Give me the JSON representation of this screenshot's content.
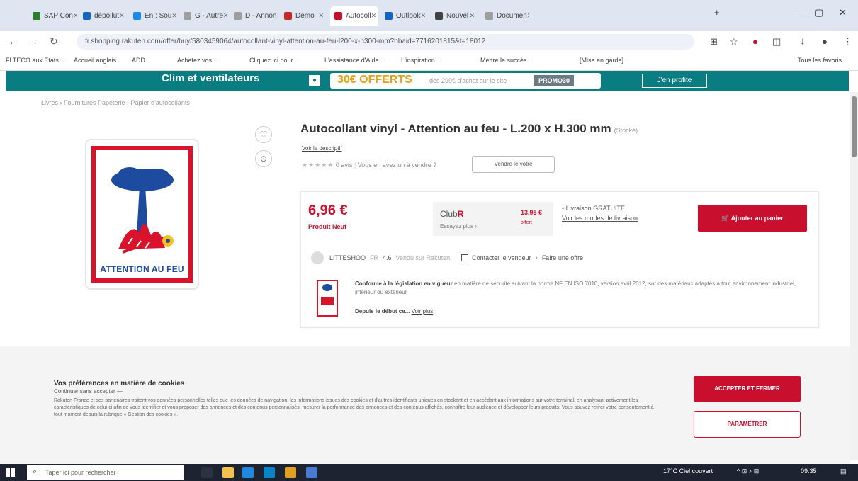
{
  "browser": {
    "tabs": [
      {
        "title": "SAP Con",
        "fav": "#2e7d32",
        "active": false
      },
      {
        "title": "dépollut",
        "fav": "#1565c0",
        "active": false
      },
      {
        "title": "En : Sou",
        "fav": "#1e88e5",
        "active": false
      },
      {
        "title": "G - Autre",
        "fav": "#9e9e9e",
        "active": false
      },
      {
        "title": "D - Annon",
        "fav": "#9e9e9e",
        "active": false
      },
      {
        "title": "Demo",
        "fav": "#c62828",
        "active": false
      },
      {
        "title": "Autocoll",
        "fav": "#c8102e",
        "active": true
      },
      {
        "title": "Outlook",
        "fav": "#1565c0",
        "active": false
      },
      {
        "title": "Nouvel",
        "fav": "#424242",
        "active": false
      },
      {
        "title": "Documen",
        "fav": "#9e9e9e",
        "active": false
      }
    ],
    "new_tab": "+",
    "url": "fr.shopping.rakuten.com/offer/buy/5803459064/autocollant-vinyl-attention-au-feu-l200-x-h300-mm?bbaid=7716201815&t=18012",
    "bookmarks": [
      "FLTECO aux Etats...",
      "Accueil anglais",
      "ADD",
      "Achetez vos...",
      "Cliquez ici pour...",
      "L'assistance d'Aide...",
      "L'inspiration...",
      "Mettre le succès...",
      "[Mise en garde]..."
    ],
    "all_bookmarks": "Tous les favoris"
  },
  "promo": {
    "title": "Clim et ventilateurs",
    "offer": "30€ OFFERTS",
    "offer_small": "dès 299€ d'achat sur le site",
    "code": "PROMO30",
    "cta": "J'en profite"
  },
  "breadcrumb": "Livres › Fournitures Papeterie › Papier d'autocollants",
  "product": {
    "image_text": "ATTENTION AU FEU",
    "title": "Autocollant vinyl - Attention au feu - L.200 x H.300 mm",
    "title_meta": "(Stocké)",
    "desc_link": "Voir le descriptif",
    "stars": "★★★★★",
    "reviews": "0 avis",
    "sell_prompt": "Vous en avez un à vendre ?",
    "sell_button": "Vendre le vôtre"
  },
  "buybox": {
    "price": "6,96 €",
    "condition": "Produit Neuf",
    "club_label": "Club",
    "club_r": "R",
    "club_sub": "Essayez plus ›",
    "club_price": "13,95 €",
    "club_save": "offert",
    "delivery_1": "• Livraison GRATUITE",
    "delivery_2": "Voir les modes de livraison",
    "add_to_cart": "Ajouter au panier",
    "seller_name": "LITTESHOO",
    "seller_country": "FR",
    "seller_rating": "4.6",
    "seller_sales": "Vendu sur Rakuten",
    "contact": "Contacter le vendeur",
    "offer": "Faire une offre",
    "conform_bold": "Conforme à la législation en vigueur",
    "conform_text": "en matière de sécurité suivant la norme NF EN ISO 7010, version avril 2012, sur des matériaux adaptés à tout environnement industriel, intérieur ou extérieur",
    "depuis": "Depuis le début ce...",
    "voir_plus": "Voir plus"
  },
  "cookie": {
    "title": "Vos préférences en matière de cookies",
    "continue": "Continuer sans accepter —",
    "body": "Rakuten France et ses partenaires traitent vos données personnelles telles que les données de navigation, les informations issues des cookies et d'autres identifiants uniques en stockant et en accédant aux informations sur votre terminal, en analysant activement les caractéristiques de celui-ci afin de vous identifier et vous proposer des annonces et des contenus personnalisés, mesurer la performance des annonces et des contenus affichés, connaître leur audience et développer leurs produits. Vous pouvez retirer votre consentement à tout moment depuis la rubrique « Gestion des cookies ».",
    "accept": "ACCEPTER ET FERMER",
    "params": "PARAMÉTRER"
  },
  "taskbar": {
    "search": "Taper ici pour rechercher",
    "weather": "17°C Ciel couvert",
    "time": "09:35"
  }
}
